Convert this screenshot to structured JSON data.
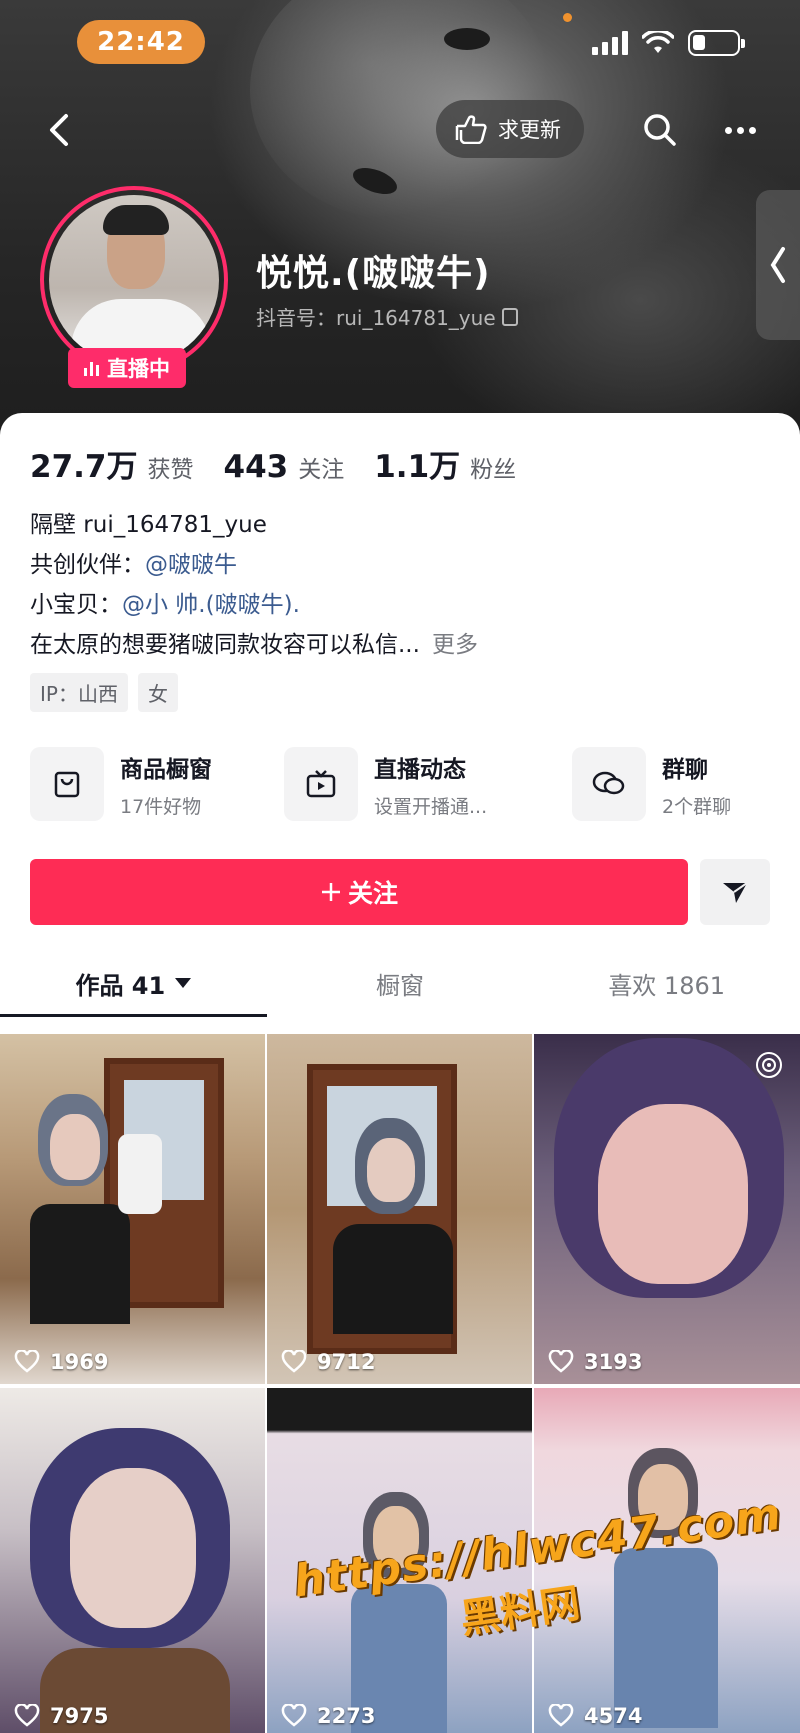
{
  "status_bar": {
    "time": "22:42"
  },
  "header": {
    "request_update_label": "求更新",
    "name": "悦悦.(啵啵牛)",
    "douyin_id": "抖音号：rui_164781_yue",
    "live_badge": "直播中"
  },
  "stats": [
    {
      "value": "27.7万",
      "label": "获赞"
    },
    {
      "value": "443",
      "label": "关注"
    },
    {
      "value": "1.1万",
      "label": "粉丝"
    }
  ],
  "bio": {
    "line1": "隔壁 rui_164781_yue",
    "line2_prefix": "共创伙伴：",
    "line2_mention": "@啵啵牛",
    "line3_prefix": "小宝贝：",
    "line3_mention": "@小 帅.(啵啵牛).",
    "line4": "在太原的想要猪啵同款妆容可以私信...",
    "more": "更多"
  },
  "tags": [
    "IP：山西",
    "女"
  ],
  "shortcuts": [
    {
      "title": "商品橱窗",
      "subtitle": "17件好物",
      "icon": "shopping-bag-icon"
    },
    {
      "title": "直播动态",
      "subtitle": "设置开播通...",
      "icon": "tv-icon"
    },
    {
      "title": "群聊",
      "subtitle": "2个群聊",
      "icon": "chat-bubbles-icon"
    }
  ],
  "follow_button": "关注",
  "tabs": [
    {
      "label": "作品 41"
    },
    {
      "label": "橱窗"
    },
    {
      "label": "喜欢 1861"
    }
  ],
  "videos": [
    {
      "likes": "1969"
    },
    {
      "likes": "9712"
    },
    {
      "likes": "3193"
    },
    {
      "likes": "7975"
    },
    {
      "likes": "2273"
    },
    {
      "likes": "4574"
    }
  ],
  "watermark": {
    "url": "https://hlwc47.com",
    "name": "黑料网"
  },
  "colors": {
    "accent": "#fe2c55",
    "mention": "#3b5b8f",
    "time_pill": "#e8903a"
  }
}
